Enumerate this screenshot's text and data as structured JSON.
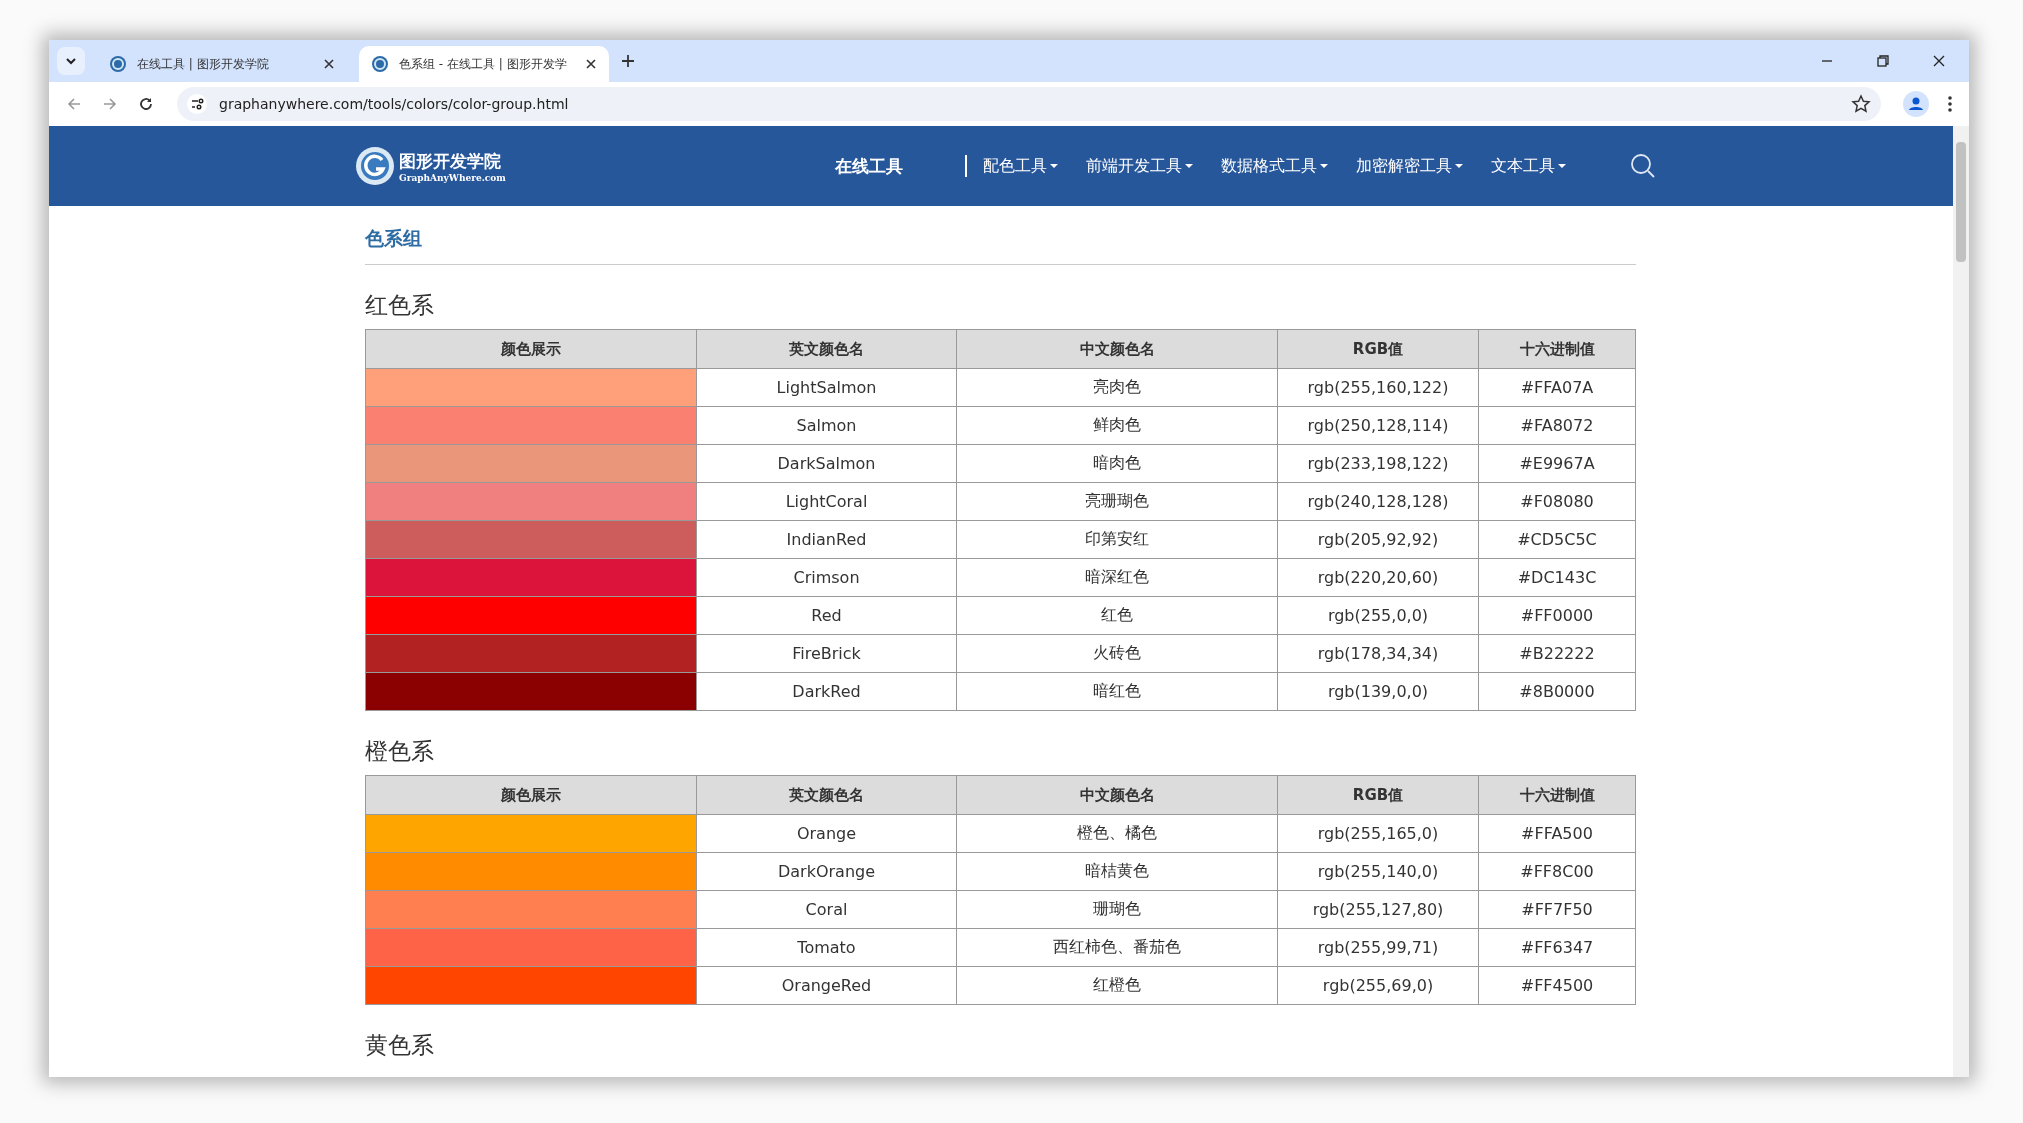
{
  "browser": {
    "tabs": [
      {
        "title": "在线工具 | 图形开发学院",
        "selected": false
      },
      {
        "title": "色系组 - 在线工具 | 图形开发学",
        "selected": true
      }
    ],
    "url": "graphanywhere.com/tools/colors/color-group.html"
  },
  "site_header": {
    "logo_title": "图形开发学院",
    "logo_subtitle": "GraphAnyWhere.com",
    "home_link": "在线工具",
    "nav": [
      "配色工具",
      "前端开发工具",
      "数据格式工具",
      "加密解密工具",
      "文本工具"
    ]
  },
  "page_title": "色系组",
  "sections": [
    {
      "heading": "红色系",
      "columns": [
        "颜色展示",
        "英文颜色名",
        "中文颜色名",
        "RGB值",
        "十六进制值"
      ],
      "rows": [
        {
          "color": "#ffa07a",
          "english": "LightSalmon",
          "chinese": "亮肉色",
          "rgb": "rgb(255,160,122)",
          "hex": "#FFA07A"
        },
        {
          "color": "#fa8072",
          "english": "Salmon",
          "chinese": "鲜肉色",
          "rgb": "rgb(250,128,114)",
          "hex": "#FA8072"
        },
        {
          "color": "#e9967a",
          "english": "DarkSalmon",
          "chinese": "暗肉色",
          "rgb": "rgb(233,198,122)",
          "hex": "#E9967A"
        },
        {
          "color": "#f08080",
          "english": "LightCoral",
          "chinese": "亮珊瑚色",
          "rgb": "rgb(240,128,128)",
          "hex": "#F08080"
        },
        {
          "color": "#cd5c5c",
          "english": "IndianRed",
          "chinese": "印第安红",
          "rgb": "rgb(205,92,92)",
          "hex": "#CD5C5C"
        },
        {
          "color": "#dc143c",
          "english": "Crimson",
          "chinese": "暗深红色",
          "rgb": "rgb(220,20,60)",
          "hex": "#DC143C"
        },
        {
          "color": "#ff0000",
          "english": "Red",
          "chinese": "红色",
          "rgb": "rgb(255,0,0)",
          "hex": "#FF0000"
        },
        {
          "color": "#b22222",
          "english": "FireBrick",
          "chinese": "火砖色",
          "rgb": "rgb(178,34,34)",
          "hex": "#B22222"
        },
        {
          "color": "#8b0000",
          "english": "DarkRed",
          "chinese": "暗红色",
          "rgb": "rgb(139,0,0)",
          "hex": "#8B0000"
        }
      ]
    },
    {
      "heading": "橙色系",
      "columns": [
        "颜色展示",
        "英文颜色名",
        "中文颜色名",
        "RGB值",
        "十六进制值"
      ],
      "rows": [
        {
          "color": "#ffa500",
          "english": "Orange",
          "chinese": "橙色、橘色",
          "rgb": "rgb(255,165,0)",
          "hex": "#FFA500"
        },
        {
          "color": "#ff8c00",
          "english": "DarkOrange",
          "chinese": "暗桔黄色",
          "rgb": "rgb(255,140,0)",
          "hex": "#FF8C00"
        },
        {
          "color": "#ff7f50",
          "english": "Coral",
          "chinese": "珊瑚色",
          "rgb": "rgb(255,127,80)",
          "hex": "#FF7F50"
        },
        {
          "color": "#ff6347",
          "english": "Tomato",
          "chinese": "西红柿色、番茄色",
          "rgb": "rgb(255,99,71)",
          "hex": "#FF6347"
        },
        {
          "color": "#ff4500",
          "english": "OrangeRed",
          "chinese": "红橙色",
          "rgb": "rgb(255,69,0)",
          "hex": "#FF4500"
        }
      ]
    },
    {
      "heading": "黄色系"
    }
  ]
}
